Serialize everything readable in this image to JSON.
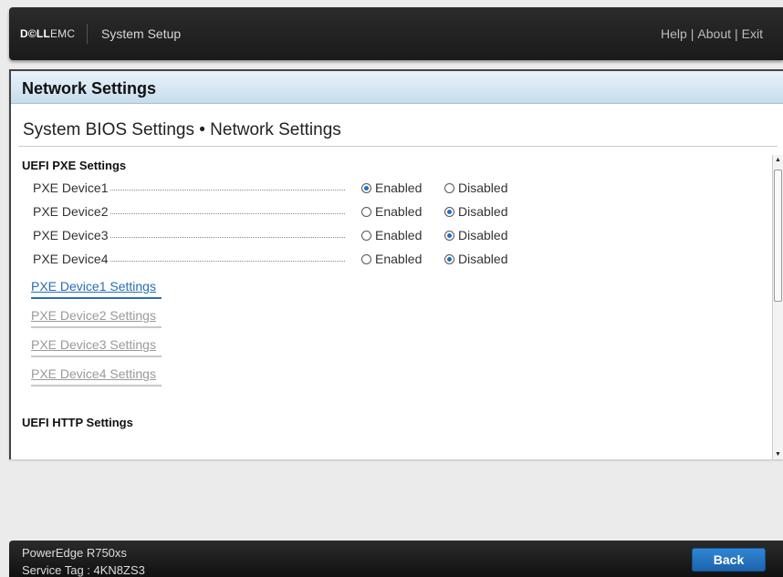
{
  "header": {
    "brand_bold": "D©LL",
    "brand_rest": "EMC",
    "app_title": "System Setup",
    "links": [
      "Help",
      "About",
      "Exit"
    ],
    "separator": "|"
  },
  "panel": {
    "header_title": "Network Settings",
    "page_title": "System BIOS Settings • Network Settings"
  },
  "pxe": {
    "section_title": "UEFI PXE Settings",
    "enabled_label": "Enabled",
    "disabled_label": "Disabled",
    "devices": [
      {
        "label": "PXE Device1",
        "value": "Enabled"
      },
      {
        "label": "PXE Device2",
        "value": "Disabled"
      },
      {
        "label": "PXE Device3",
        "value": "Disabled"
      },
      {
        "label": "PXE Device4",
        "value": "Disabled"
      }
    ],
    "settings_links": [
      {
        "label": "PXE Device1 Settings",
        "active": true
      },
      {
        "label": "PXE Device2 Settings",
        "active": false
      },
      {
        "label": "PXE Device3 Settings",
        "active": false
      },
      {
        "label": "PXE Device4 Settings",
        "active": false
      }
    ]
  },
  "http": {
    "section_title": "UEFI HTTP Settings"
  },
  "footer": {
    "model": "PowerEdge R750xs",
    "service_tag": "Service Tag : 4KN8ZS3",
    "back_label": "Back"
  },
  "colors": {
    "accent": "#2a6db3",
    "header_gradient_top": "#eaf3fb",
    "header_gradient_bottom": "#c7dcec",
    "topbar": "#1f1f1f"
  },
  "icons": {
    "radio_selected": "radio-selected-icon",
    "radio_unselected": "radio-unselected-icon",
    "scroll_up": "triangle-up-icon",
    "scroll_down": "triangle-down-icon"
  }
}
